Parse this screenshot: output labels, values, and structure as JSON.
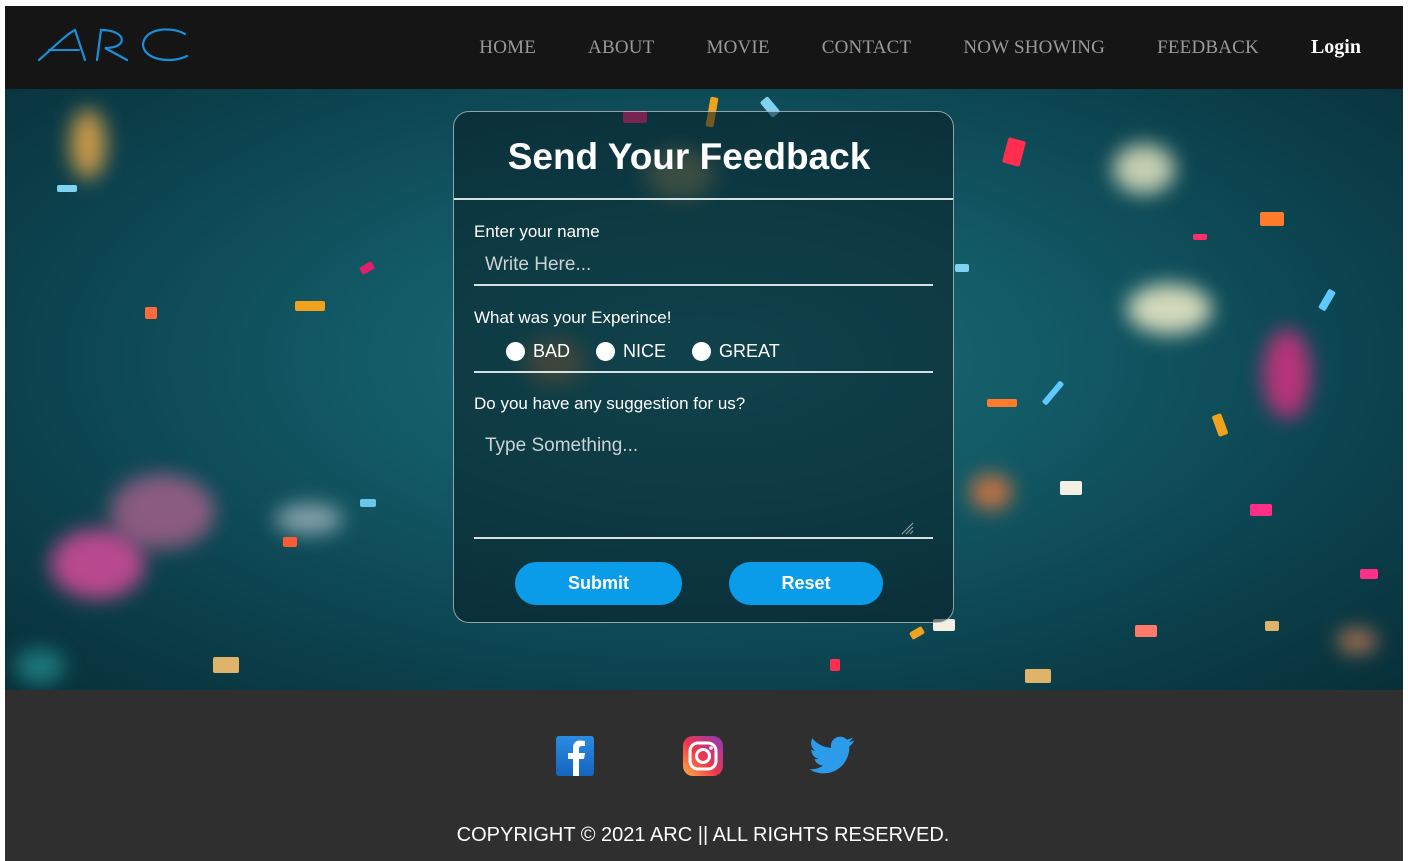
{
  "brand": {
    "logo_text": "ARC",
    "accent": "#1a8fd8"
  },
  "nav": {
    "items": [
      "HOME",
      "ABOUT",
      "MOVIE",
      "CONTACT",
      "NOW SHOWING",
      "FEEDBACK"
    ],
    "login": "Login"
  },
  "form": {
    "title": "Send Your Feedback",
    "name_label": "Enter your name",
    "name_placeholder": "Write Here...",
    "experience_label": "What was your Experince!",
    "experience_options": [
      "BAD",
      "NICE",
      "GREAT"
    ],
    "suggestion_label": "Do you have any suggestion for us?",
    "suggestion_placeholder": "Type Something...",
    "submit_label": "Submit",
    "reset_label": "Reset",
    "button_color": "#0a9be9"
  },
  "footer": {
    "social": [
      "facebook-icon",
      "instagram-icon",
      "twitter-icon"
    ],
    "copyright": "COPYRIGHT © 2021 ARC || ALL RIGHTS RESERVED."
  }
}
